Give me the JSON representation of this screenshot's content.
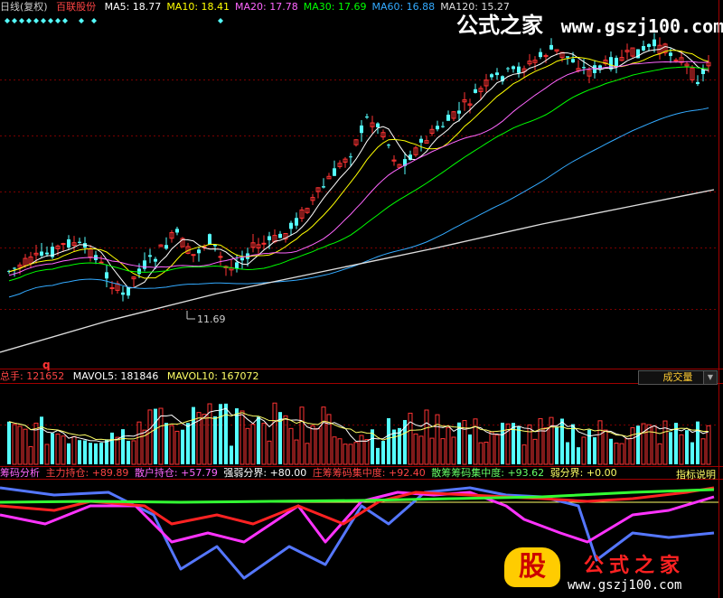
{
  "header": {
    "period": "日线(复权)",
    "stock_name": "百联股份",
    "ma": [
      {
        "label": "MA5:",
        "value": "18.77",
        "color": "#ffffff"
      },
      {
        "label": "MA10:",
        "value": "18.41",
        "color": "#ffff00"
      },
      {
        "label": "MA20:",
        "value": "17.78",
        "color": "#ff66ff"
      },
      {
        "label": "MA30:",
        "value": "17.69",
        "color": "#00ff00"
      },
      {
        "label": "MA60:",
        "value": "16.88",
        "color": "#33aaff"
      },
      {
        "label": "MA120:",
        "value": "15.27",
        "color": "#dddddd"
      }
    ]
  },
  "watermark": {
    "title": "公式之家",
    "url": "www.gszj100.com"
  },
  "price_panel": {
    "low_label": "11.69",
    "q_mark": "q"
  },
  "volume_panel": {
    "total_label": "总手:",
    "total_value": "121652",
    "mavol5_label": "MAVOL5:",
    "mavol5_value": "181846",
    "mavol10_label": "MAVOL10:",
    "mavol10_value": "167072",
    "selector": "成交量"
  },
  "chip_panel": {
    "title": "筹码分析",
    "main_label": "主力持仓:",
    "main_value": "+89.89",
    "retail_label": "散户持仓:",
    "retail_value": "+57.79",
    "strong_label": "强弱分界:",
    "strong_value": "+80.00",
    "conc_label": "庄筹筹码集中度:",
    "conc_value": "+92.40",
    "scatter_label": "散筹筹码集中度:",
    "scatter_value": "+93.62",
    "weak_label": "弱分界:",
    "weak_value": "+0.00",
    "help": "指标说明"
  },
  "bottom_logo": {
    "glyph": "股",
    "title": "公式之家",
    "url": "www.gszj100.com"
  },
  "colors": {
    "up": "#ff3333",
    "down": "#55ffff",
    "grid": "#7a0000",
    "ma5": "#ffffff",
    "ma10": "#ffff00",
    "ma20": "#ff66ff",
    "ma30": "#00ff00",
    "ma60": "#33aaff",
    "ma120": "#dddddd"
  }
}
